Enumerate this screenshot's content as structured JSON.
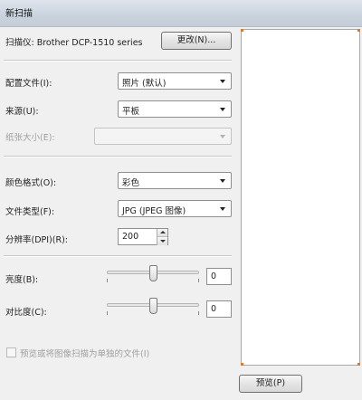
{
  "window": {
    "title": "新扫描"
  },
  "scanner": {
    "label": "扫描仪: Brother DCP-1510 series",
    "change_button": "更改(N)..."
  },
  "profile": {
    "label": "配置文件(I):",
    "value": "照片 (默认)"
  },
  "source": {
    "label": "来源(U):",
    "value": "平板"
  },
  "paper_size": {
    "label": "纸张大小(E):",
    "value": ""
  },
  "color_format": {
    "label": "颜色格式(O):",
    "value": "彩色"
  },
  "file_type": {
    "label": "文件类型(F):",
    "value": "JPG (JPEG 图像)"
  },
  "resolution": {
    "label": "分辨率(DPI)(R):",
    "value": "200"
  },
  "brightness": {
    "label": "亮度(B):",
    "value": "0",
    "level": 0.5
  },
  "contrast": {
    "label": "对比度(C):",
    "value": "0",
    "level": 0.5
  },
  "separate_files": {
    "label": "预览或将图像扫描为单独的文件(I)",
    "checked": false
  },
  "buttons": {
    "preview": "预览(P)"
  },
  "colors": {
    "accent_corner": "#e0782c"
  }
}
